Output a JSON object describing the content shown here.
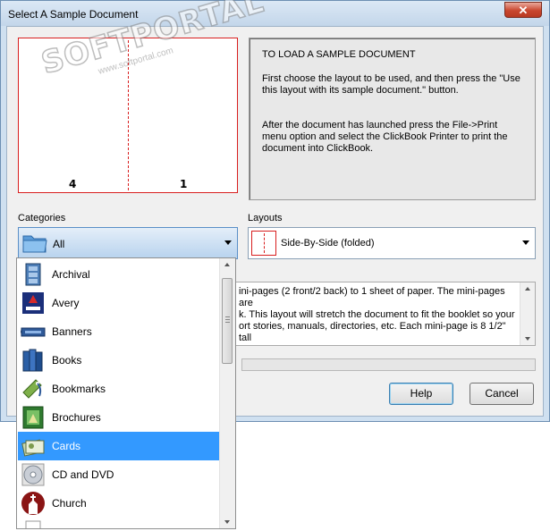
{
  "window": {
    "title": "Select A Sample Document",
    "close_glyph": "✕"
  },
  "preview": {
    "page_left": "4",
    "page_right": "1"
  },
  "instructions": {
    "heading": "TO LOAD A SAMPLE DOCUMENT",
    "para1": "First choose the layout to be used, and then press the \"Use this layout with its sample document.\" button.",
    "para2": "After the document has launched press the File->Print menu option and select the ClickBook Printer to print the document into ClickBook."
  },
  "categories": {
    "label": "Categories",
    "value": "All",
    "icon": "folder-icon"
  },
  "layouts": {
    "label": "Layouts",
    "value": "Side-By-Side (folded)"
  },
  "description": {
    "line1": "ini-pages (2 front/2 back) to 1 sheet of paper. The mini-pages are",
    "line2": "k.  This layout will stretch the document to fit the booklet so your",
    "line3": "ort stories, manuals, directories, etc.  Each mini-page is 8 1/2\" tall"
  },
  "buttons": {
    "help": "Help",
    "cancel": "Cancel"
  },
  "category_list": [
    {
      "label": "Archival",
      "icon": "archive-cabinet-icon"
    },
    {
      "label": "Avery",
      "icon": "avery-logo-icon"
    },
    {
      "label": "Banners",
      "icon": "banner-icon"
    },
    {
      "label": "Books",
      "icon": "books-icon"
    },
    {
      "label": "Bookmarks",
      "icon": "bookmark-icon"
    },
    {
      "label": "Brochures",
      "icon": "brochure-icon"
    },
    {
      "label": "Cards",
      "icon": "cards-icon",
      "selected": true
    },
    {
      "label": "CD and DVD",
      "icon": "cd-icon"
    },
    {
      "label": "Church",
      "icon": "church-icon"
    }
  ],
  "watermark": {
    "brand": "SOFTPORTAL",
    "url": "www.softportal.com"
  },
  "colors": {
    "selection": "#3399ff",
    "fold_line": "#d81e1e",
    "combo_focus": "#5a8fc7"
  }
}
